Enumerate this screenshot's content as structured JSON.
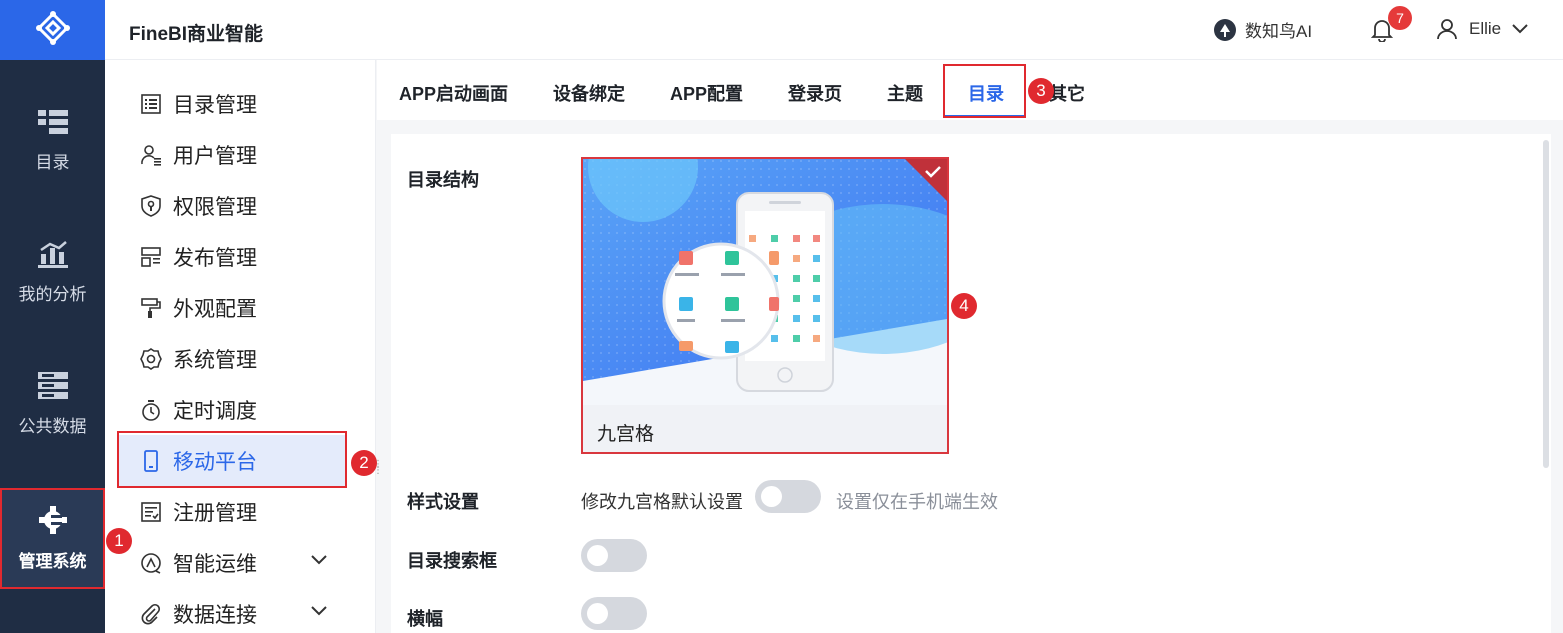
{
  "app": {
    "title": "FineBI商业智能"
  },
  "header": {
    "ai_label": "数知鸟AI",
    "notification_count": "7",
    "user_name": "Ellie"
  },
  "rail": {
    "items": [
      {
        "label": "目录",
        "icon": "catalog-icon"
      },
      {
        "label": "我的分析",
        "icon": "analysis-chart-icon"
      },
      {
        "label": "公共数据",
        "icon": "database-icon"
      },
      {
        "label": "管理系统",
        "icon": "gear-icon",
        "active": true
      }
    ]
  },
  "menu": {
    "items": [
      {
        "label": "目录管理",
        "icon": "list-icon"
      },
      {
        "label": "用户管理",
        "icon": "user-icon"
      },
      {
        "label": "权限管理",
        "icon": "shield-icon"
      },
      {
        "label": "发布管理",
        "icon": "publish-icon"
      },
      {
        "label": "外观配置",
        "icon": "paint-roller-icon"
      },
      {
        "label": "系统管理",
        "icon": "settings-icon"
      },
      {
        "label": "定时调度",
        "icon": "stopwatch-icon"
      },
      {
        "label": "移动平台",
        "icon": "mobile-icon",
        "active": true
      },
      {
        "label": "注册管理",
        "icon": "register-icon"
      },
      {
        "label": "智能运维",
        "icon": "ops-icon",
        "expandable": true
      },
      {
        "label": "数据连接",
        "icon": "paperclip-icon",
        "expandable": true
      }
    ]
  },
  "tabs": [
    "APP启动画面",
    "设备绑定",
    "APP配置",
    "登录页",
    "主题",
    "目录",
    "其它"
  ],
  "active_tab": "目录",
  "form": {
    "catalog_structure_label": "目录结构",
    "layout_option": "九宫格",
    "style_label": "样式设置",
    "style_toggle_text": "修改九宫格默认设置",
    "style_hint": "设置仅在手机端生效",
    "search_label": "目录搜索框",
    "banner_label": "横幅"
  },
  "annotations": [
    "1",
    "2",
    "3",
    "4"
  ],
  "colors": {
    "accent": "#2b67e8",
    "rail_bg": "#1f2d44",
    "annotation_red": "#e0292f"
  }
}
